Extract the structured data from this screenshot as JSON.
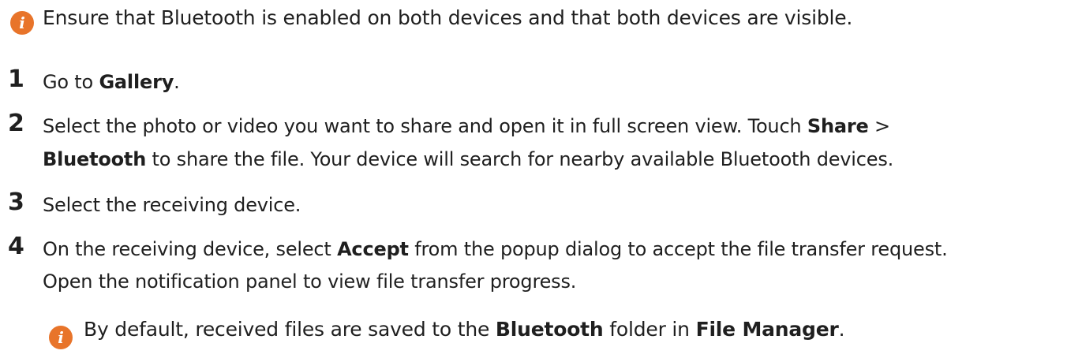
{
  "notes": {
    "top": "Ensure that Bluetooth is enabled on both devices and that both devices are visible.",
    "bottom": {
      "pre": "By default, received files are saved to the ",
      "bold1": "Bluetooth",
      "mid": " folder in ",
      "bold2": "File Manager",
      "post": "."
    }
  },
  "steps": [
    {
      "number": "1",
      "lines": [
        {
          "pre": "Go to ",
          "bold": "Gallery",
          "post": "."
        }
      ]
    },
    {
      "number": "2",
      "lines": [
        {
          "pre": "Select the photo or video you want to share and open it in full screen view. Touch ",
          "bold": "Share",
          "post": " >"
        },
        {
          "pre": "",
          "bold": "Bluetooth",
          "post": " to share the file. Your device will search for nearby available Bluetooth devices."
        }
      ]
    },
    {
      "number": "3",
      "lines": [
        {
          "pre": "Select the receiving device.",
          "bold": "",
          "post": ""
        }
      ]
    },
    {
      "number": "4",
      "lines": [
        {
          "pre": "On the receiving device, select ",
          "bold": "Accept",
          "post": " from the popup dialog to accept the file transfer request."
        },
        {
          "pre": "Open the notification panel to view file transfer progress.",
          "bold": "",
          "post": ""
        }
      ]
    }
  ],
  "icons": {
    "info": "info-icon",
    "color": "#e8742a"
  }
}
